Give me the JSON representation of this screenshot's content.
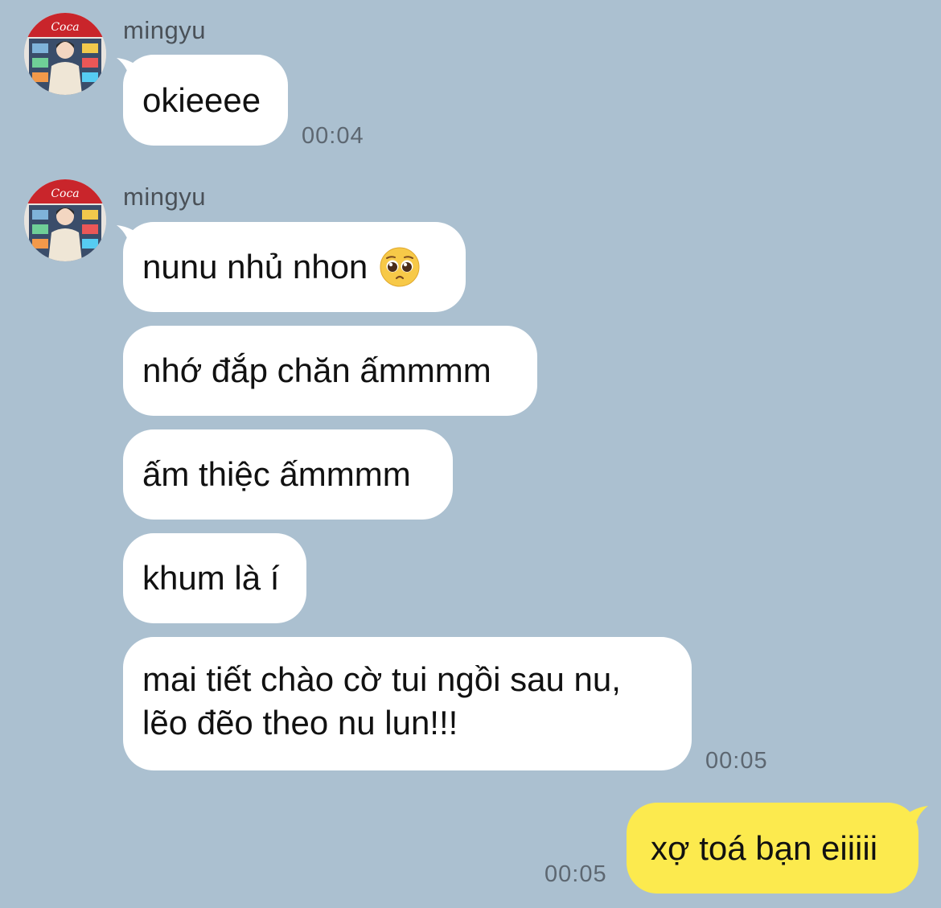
{
  "messages": [
    {
      "sender": "mingyu",
      "bubbles": [
        "okieeee"
      ],
      "time": "00:04"
    },
    {
      "sender": "mingyu",
      "bubbles": [
        "nunu nhủ nhon",
        "nhớ đắp chăn ấmmmm",
        "ấm thiệc ấmmmm",
        "khum là í"
      ],
      "multiline": {
        "line1": "mai tiết chào cờ tui ngồi sau nu,",
        "line2": "lẽo đẽo theo nu lun!!!"
      },
      "emoji": "pleading-face",
      "time": "00:05"
    }
  ],
  "mine": {
    "text": "xợ toá bạn eiiiii",
    "time": "00:05"
  },
  "colors": {
    "background": "#abc0d0",
    "incoming_bubble": "#ffffff",
    "outgoing_bubble": "#fcea4e"
  }
}
